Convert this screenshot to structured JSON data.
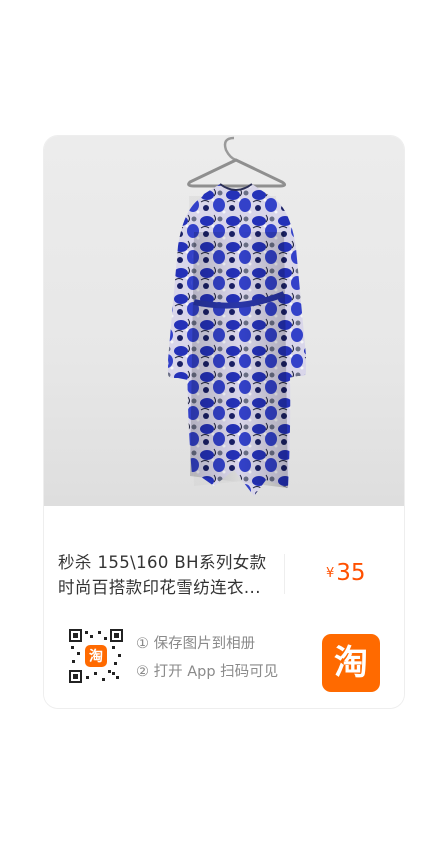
{
  "product": {
    "title_line1": "秒杀 155\\160  BH系列女款",
    "title_line2": "时尚百搭款印花雪纺连衣...",
    "currency": "¥",
    "price": "35",
    "price_color": "#ff5000"
  },
  "share": {
    "step1": "① 保存图片到相册",
    "step2": "② 打开 App 扫码可见",
    "qr_badge": "淘",
    "app_icon_label": "淘",
    "app_icon_color": "#ff6a00"
  },
  "image": {
    "subject": "blue floral chiffon dress on hanger",
    "icon_name": "product-photo"
  }
}
